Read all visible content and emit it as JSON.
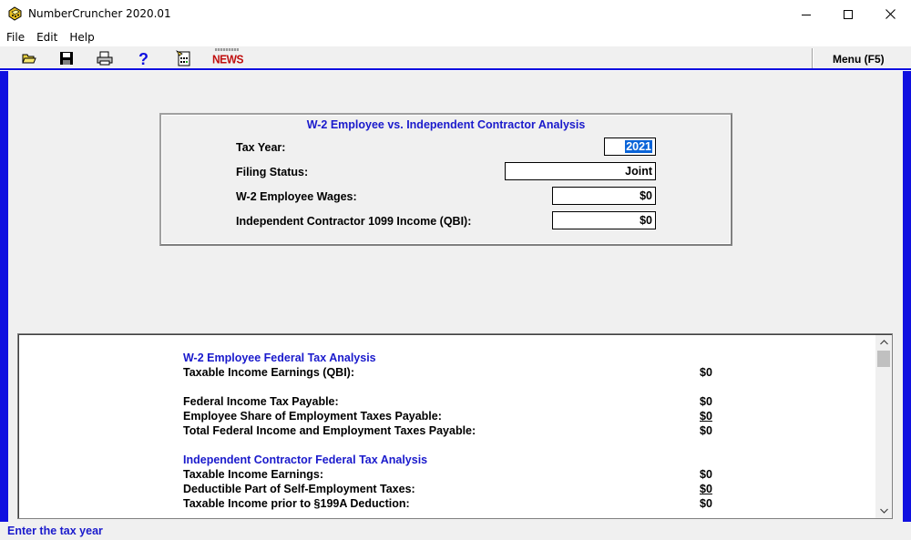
{
  "window": {
    "title": "NumberCruncher 2020.01"
  },
  "menu": {
    "file": "File",
    "edit": "Edit",
    "help": "Help"
  },
  "toolbar": {
    "icons": [
      "open-folder-icon",
      "save-disk-icon",
      "printer-icon",
      "help-question-icon",
      "calculator-icon",
      "news-icon"
    ],
    "news_label": "NEWS",
    "menu_label": "Menu (F5)"
  },
  "panel": {
    "title": "W-2 Employee vs. Independent Contractor Analysis",
    "tax_year_label": "Tax Year:",
    "tax_year_value": "2021",
    "filing_status_label": "Filing Status:",
    "filing_status_value": "Joint",
    "wages_label": "W-2 Employee Wages:",
    "wages_value": "$0",
    "contractor_label": "Independent Contractor 1099 Income (QBI):",
    "contractor_value": "$0"
  },
  "results": {
    "w2_heading": "W-2 Employee Federal Tax Analysis",
    "w2_rows": [
      {
        "label": "Taxable Income Earnings (QBI):",
        "value": "$0"
      },
      {
        "label": "Federal Income Tax Payable:",
        "value": "$0"
      },
      {
        "label": "Employee Share of Employment Taxes Payable:",
        "value": "$0"
      },
      {
        "label": "Total Federal Income and Employment Taxes Payable:",
        "value": "$0"
      }
    ],
    "ic_heading": "Independent Contractor Federal Tax Analysis",
    "ic_rows": [
      {
        "label": "Taxable Income Earnings:",
        "value": "$0"
      },
      {
        "label": "Deductible Part of Self-Employment Taxes:",
        "value": "$0"
      },
      {
        "label": "Taxable Income prior to §199A Deduction:",
        "value": "$0"
      }
    ]
  },
  "status": {
    "text": "Enter the tax year"
  },
  "colors": {
    "accent_blue": "#1010e0",
    "heading_blue": "#1a1acc",
    "news_red": "#c01010"
  }
}
